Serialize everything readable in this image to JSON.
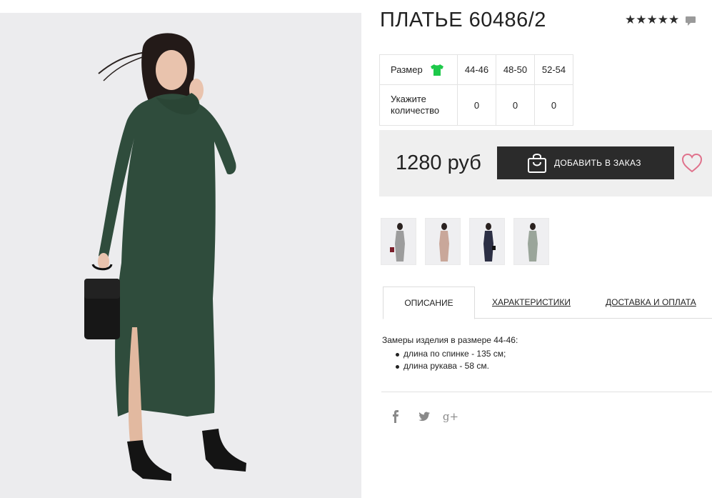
{
  "product": {
    "title": "ПЛАТЬЕ 60486/2",
    "rating_stars": "★★★★★",
    "rating_value": 5,
    "rating_max": 5
  },
  "size_table": {
    "size_label": "Размер",
    "sizes": [
      "44-46",
      "48-50",
      "52-54"
    ],
    "qty_label_line1": "Укажите",
    "qty_label_line2": "количество",
    "quantities": [
      "0",
      "0",
      "0"
    ]
  },
  "buy": {
    "price": "1280 руб",
    "add_button_label": "ДОБАВИТЬ В ЗАКАЗ"
  },
  "thumbnails": [
    {
      "dress_color": "#9c9c9c"
    },
    {
      "dress_color": "#c9a79a"
    },
    {
      "dress_color": "#2c2f44"
    },
    {
      "dress_color": "#9aa59a"
    }
  ],
  "tabs": [
    {
      "label": "ОПИСАНИЕ",
      "active": true
    },
    {
      "label": "ХАРАКТЕРИСТИКИ",
      "active": false
    },
    {
      "label": "ДОСТАВКА И ОПЛАТА",
      "active": false
    }
  ],
  "description": {
    "intro": "Замеры изделия в размере 44-46:",
    "items": [
      "длина по спинке - 135 см;",
      "длина рукава - 58 см."
    ]
  },
  "social": {
    "facebook_glyph": "f",
    "google_glyph": "g+"
  },
  "colors": {
    "dress_green": "#2f4c3c",
    "button_dark": "#2b2b2b",
    "heart_pink": "#e0728c",
    "size_icon_green": "#1ec94a"
  },
  "icons": {
    "size": "tshirt-icon",
    "comment": "comment-icon",
    "cart": "shopping-bag-icon",
    "wishlist": "heart-icon",
    "share": [
      "facebook-icon",
      "twitter-icon",
      "google-plus-icon"
    ]
  }
}
